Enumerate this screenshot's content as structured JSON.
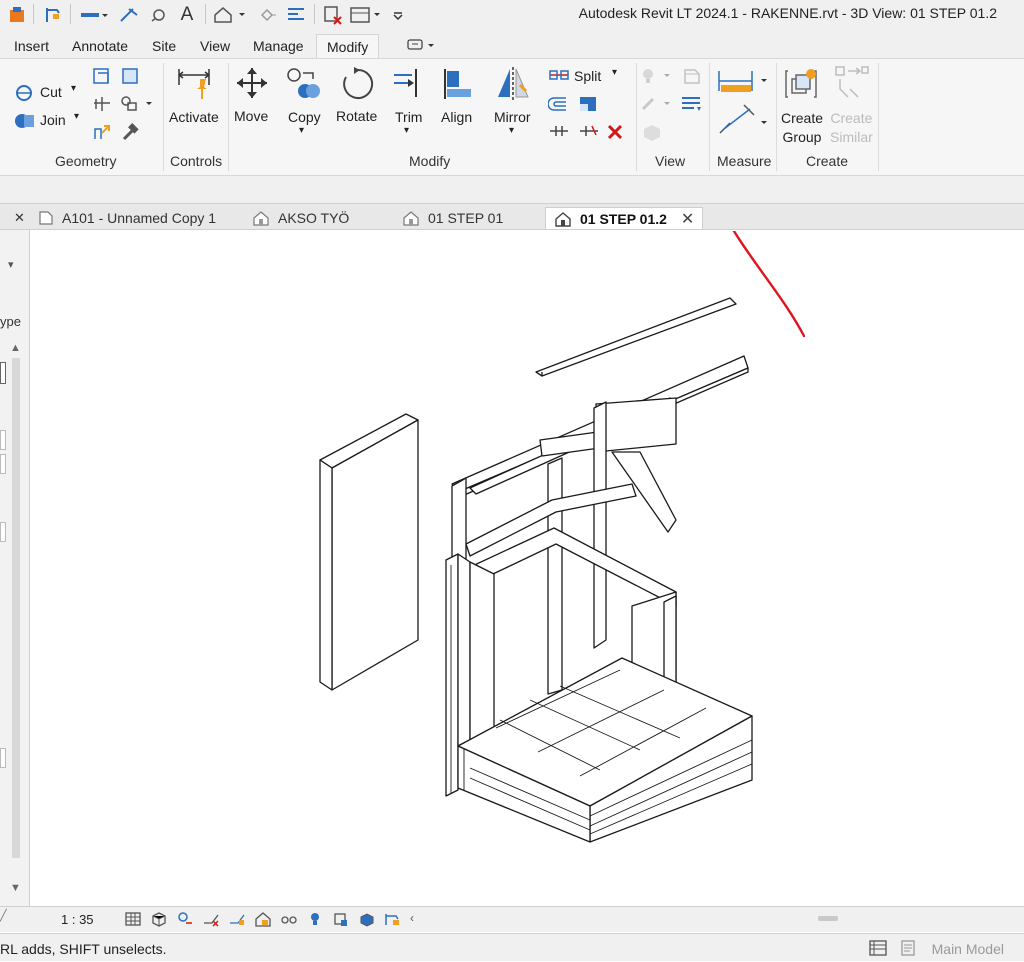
{
  "title_bar": {
    "title": "Autodesk Revit LT 2024.1 - RAKENNE.rvt - 3D View: 01 STEP 01.2"
  },
  "quick_access": {
    "text_tool_glyph": "A"
  },
  "ribbon_tabs": [
    {
      "label": "Insert"
    },
    {
      "label": "Annotate"
    },
    {
      "label": "Site"
    },
    {
      "label": "View"
    },
    {
      "label": "Manage"
    },
    {
      "label": "Modify",
      "active": true
    }
  ],
  "ribbon": {
    "geometry": {
      "cut_label": "Cut",
      "join_label": "Join",
      "panel_label": "Geometry"
    },
    "controls": {
      "activate_label": "Activate",
      "panel_label": "Controls"
    },
    "modify": {
      "move_label": "Move",
      "copy_label": "Copy",
      "rotate_label": "Rotate",
      "trim_label": "Trim",
      "align_label": "Align",
      "mirror_label": "Mirror",
      "split_label": "Split",
      "panel_label": "Modify"
    },
    "view": {
      "panel_label": "View"
    },
    "measure": {
      "panel_label": "Measure"
    },
    "create": {
      "create_group_line1": "Create",
      "create_group_line2": "Group",
      "create_similar_line1": "Create",
      "create_similar_line2": "Similar",
      "panel_label": "Create"
    }
  },
  "view_tabs": [
    {
      "label": "A101 - Unnamed Copy 1",
      "icon": "sheet-icon"
    },
    {
      "label": "AKSO TYÖ",
      "icon": "house-icon"
    },
    {
      "label": "01 STEP 01",
      "icon": "house-icon"
    },
    {
      "label": "01 STEP 01.2",
      "icon": "house-icon",
      "active": true
    }
  ],
  "left_panel": {
    "type_fragment": "ype"
  },
  "view_control_bar": {
    "scale": "1 : 35"
  },
  "status_bar": {
    "message": "RL adds, SHIFT unselects.",
    "model": "Main Model"
  },
  "colors": {
    "accent_blue": "#2c6fbf",
    "annotation_red": "#e0141e",
    "pin_orange": "#f0a020"
  }
}
